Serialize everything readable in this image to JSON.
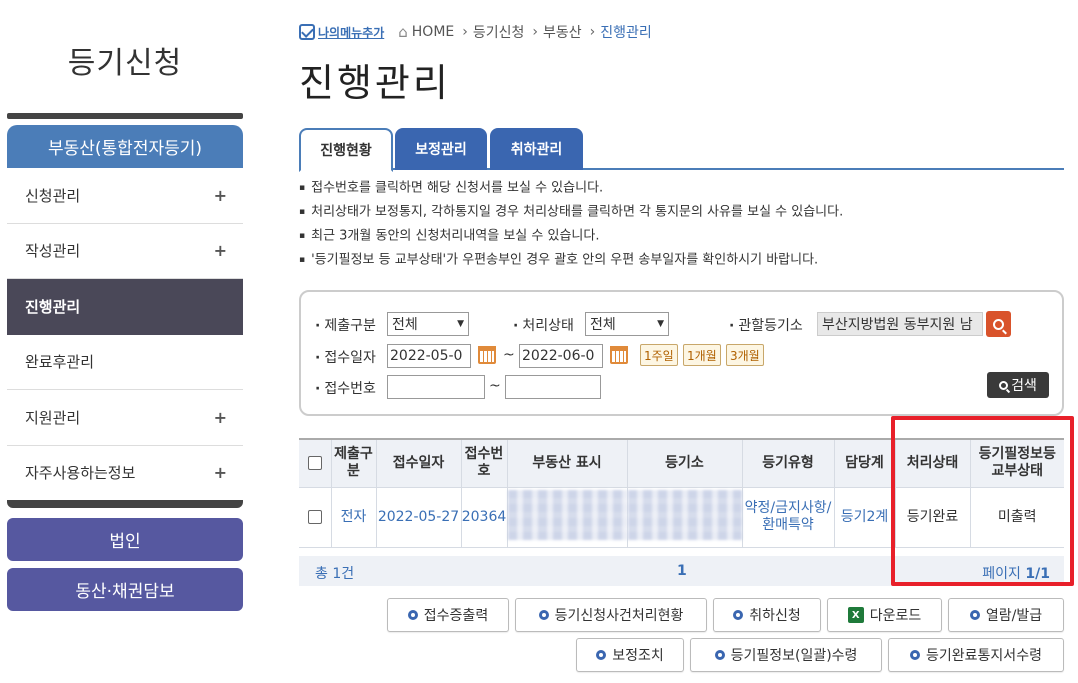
{
  "sidebar": {
    "title": "등기신청",
    "head": "부동산(통합전자등기)",
    "items": [
      {
        "label": "신청관리",
        "plus": "+"
      },
      {
        "label": "작성관리",
        "plus": "+"
      },
      {
        "label": "진행관리",
        "plus": ""
      },
      {
        "label": "완료후관리",
        "plus": ""
      },
      {
        "label": "지원관리",
        "plus": "+"
      },
      {
        "label": "자주사용하는정보",
        "plus": "+"
      }
    ],
    "btn_corp": "법인",
    "btn_movable": "동산·채권담보"
  },
  "breadcrumb": {
    "my_menu": "나의메뉴추가",
    "home": "HOME",
    "c1": "등기신청",
    "c2": "부동산",
    "c3": "진행관리"
  },
  "page_title": "진행관리",
  "tabs": [
    "진행현황",
    "보정관리",
    "취하관리"
  ],
  "notes": [
    "접수번호를 클릭하면 해당 신청서를 보실 수 있습니다.",
    "처리상태가 보정통지, 각하통지일 경우 처리상태를 클릭하면 각 통지문의 사유를 보실 수 있습니다.",
    "최근 3개월 동안의 신청처리내역을 보실 수 있습니다.",
    "'등기필정보 등 교부상태'가 우편송부인 경우 괄호 안의 우편 송부일자를 확인하시기 바랍니다."
  ],
  "search": {
    "submit_type_label": "제출구분",
    "submit_type_value": "전체",
    "status_label": "처리상태",
    "status_value": "전체",
    "court_label": "관할등기소",
    "court_value": "부산지방법원 동부지원 남",
    "date_label": "접수일자",
    "date_from": "2022-05-0",
    "date_to": "2022-06-0",
    "tilde": "~",
    "periods": [
      "1주일",
      "1개월",
      "3개월"
    ],
    "receipt_label": "접수번호",
    "receipt_from": "",
    "receipt_to": "",
    "search_btn": "검색"
  },
  "table": {
    "headers": [
      "제출구분",
      "접수일자",
      "접수번호",
      "부동산 표시",
      "등기소",
      "등기유형",
      "담당계",
      "처리상태",
      "등기필정보등 교부상태"
    ],
    "row": {
      "submit": "전자",
      "date": "2022-05-27",
      "receipt": "20364",
      "property": "",
      "office": "",
      "type": "약정/금지사항/환매특약",
      "team": "등기2계",
      "status": "등기완료",
      "delivery": "미출력"
    },
    "total": "총 1건",
    "page": "1",
    "pages_prefix": "페이지 ",
    "pages": "1/1"
  },
  "actions": {
    "receipt_print": "접수증출력",
    "status_case": "등기신청사건처리현황",
    "withdraw": "취하신청",
    "download": "다운로드",
    "view_issue": "열람/발급",
    "correction": "보정조치",
    "bulk_receive": "등기필정보(일괄)수령",
    "complete_notice": "등기완료통지서수령"
  }
}
